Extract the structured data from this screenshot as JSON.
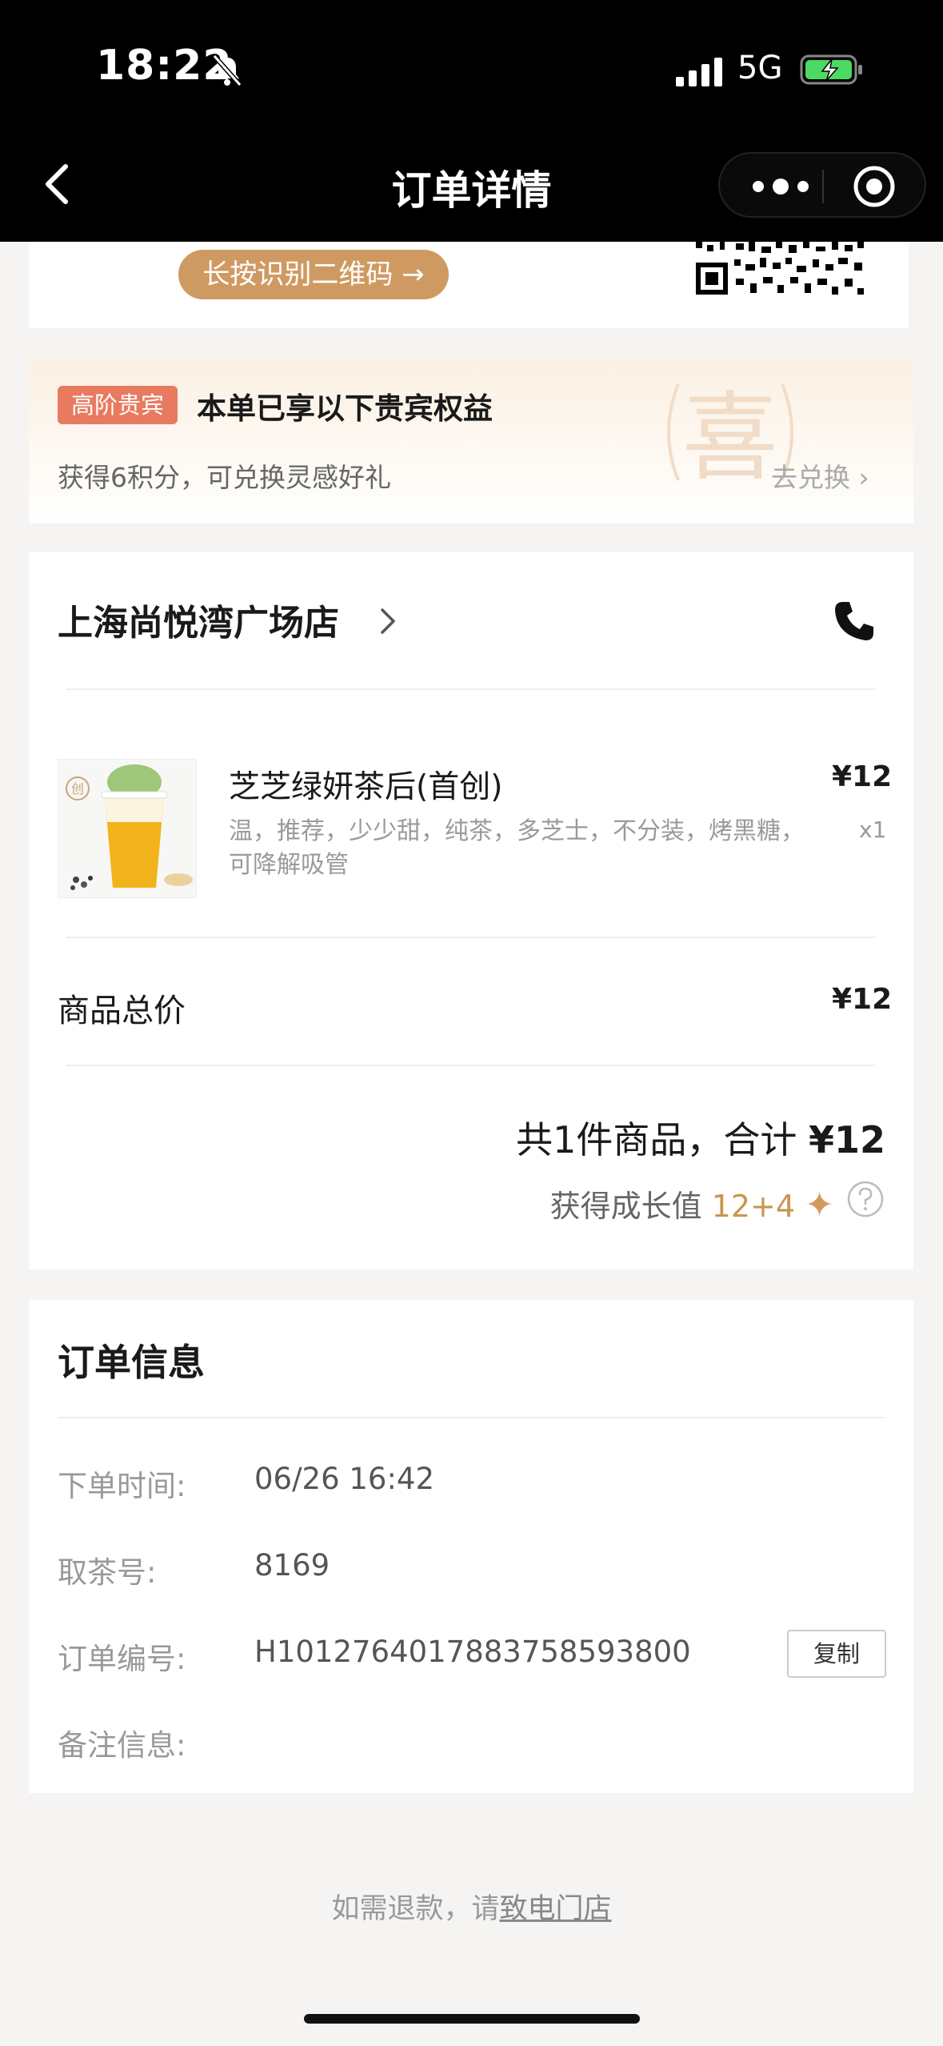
{
  "status_bar": {
    "time": "18:22",
    "network": "5G"
  },
  "nav": {
    "title": "订单详情"
  },
  "qr": {
    "button_label": "长按识别二维码 →"
  },
  "vip": {
    "tag": "高阶贵宾",
    "title": "本单已享以下贵宾权益",
    "subtitle": "获得6积分，可兑换灵感好礼",
    "link": "去兑换 ›",
    "watermark": "喜"
  },
  "store": {
    "name": "上海尚悦湾广场店"
  },
  "product": {
    "name": "芝芝绿妍茶后(首创)",
    "options": "温，推荐，少少甜，纯茶，多芝士，不分装，烤黑糖，可降解吸管",
    "price": "¥12",
    "qty": "x1",
    "badge": "创"
  },
  "totals": {
    "label": "商品总价",
    "value": "¥12",
    "summary_prefix": "共1件商品，合计 ",
    "summary_amount": "¥12",
    "growth_label": "获得成长值 ",
    "growth_value": "12+4",
    "growth_star": "✦"
  },
  "order_info": {
    "title": "订单信息",
    "rows": [
      {
        "label": "下单时间:",
        "value": "06/26 16:42"
      },
      {
        "label": "取茶号:",
        "value": "8169"
      },
      {
        "label": "订单编号:",
        "value": "H1012764017883758593800"
      },
      {
        "label": "备注信息:",
        "value": ""
      }
    ],
    "copy_label": "复制"
  },
  "footer": {
    "refund_prefix": "如需退款，请",
    "refund_link": "致电门店"
  },
  "colors": {
    "accent": "#cf9a62",
    "vip_tag": "#e87a5f",
    "growth": "#c9964e"
  }
}
